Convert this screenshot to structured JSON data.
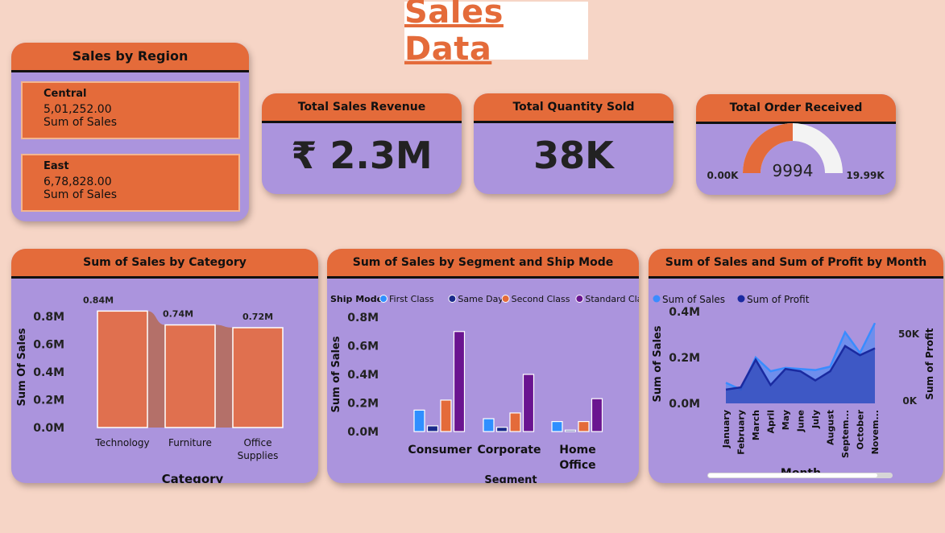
{
  "page": {
    "title": "Sales Data"
  },
  "sales_by_region": {
    "title": "Sales by Region",
    "items": [
      {
        "region": "Central",
        "value": "5,01,252.00",
        "measure": "Sum of Sales"
      },
      {
        "region": "East",
        "value": "6,78,828.00",
        "measure": "Sum of Sales"
      }
    ]
  },
  "kpis": {
    "revenue": {
      "title": "Total Sales Revenue",
      "value": "₹ 2.3M"
    },
    "quantity": {
      "title": "Total Quantity Sold",
      "value": "38K"
    },
    "orders": {
      "title": "Total Order Received",
      "value": "9994",
      "min_label": "0.00K",
      "max_label": "19.99K",
      "value_num": 9994,
      "max_num": 19990
    }
  },
  "colors": {
    "background": "#f6d5c6",
    "card": "#ab94dd",
    "accent": "#e46b3a",
    "first_class": "#2f8fff",
    "same_day": "#1a2a8a",
    "second_class": "#e46b3a",
    "standard_class": "#6a1490",
    "sales": "#3a8cff",
    "profit": "#1a2aa0"
  },
  "chart_data": [
    {
      "type": "bar",
      "title": "Sum of Sales by Category",
      "xlabel": "Category",
      "ylabel": "Sum Of Sales",
      "ylim": [
        0,
        0.9
      ],
      "yticks": [
        "0.0M",
        "0.2M",
        "0.4M",
        "0.6M",
        "0.8M"
      ],
      "categories": [
        "Technology",
        "Furniture",
        "Office Supplies"
      ],
      "values": [
        0.84,
        0.74,
        0.72
      ],
      "data_labels": [
        "0.84M",
        "0.74M",
        "0.72M"
      ]
    },
    {
      "type": "bar",
      "title": "Sum of Sales by Segment and Ship Mode",
      "xlabel": "Segment",
      "ylabel": "Sum of Sales",
      "legend_title": "Ship Mode",
      "legend_position": "top-left",
      "ylim": [
        0,
        0.8
      ],
      "yticks": [
        "0.0M",
        "0.2M",
        "0.4M",
        "0.6M",
        "0.8M"
      ],
      "categories": [
        "Consumer",
        "Corporate",
        "Home Office"
      ],
      "series": [
        {
          "name": "First Class",
          "values": [
            0.15,
            0.09,
            0.07
          ]
        },
        {
          "name": "Same Day",
          "values": [
            0.04,
            0.03,
            0.01
          ]
        },
        {
          "name": "Second Class",
          "values": [
            0.22,
            0.13,
            0.07
          ]
        },
        {
          "name": "Standard Class",
          "values": [
            0.7,
            0.4,
            0.23
          ]
        }
      ]
    },
    {
      "type": "area",
      "title": "Sum of Sales and Sum of Profit by Month",
      "xlabel": "Month",
      "ylabel": "Sum of Sales",
      "y2label": "Sum of Profit",
      "legend_position": "top-left",
      "ylim": [
        0,
        0.4
      ],
      "yticks": [
        "0.0M",
        "0.2M",
        "0.4M"
      ],
      "y2ticks": [
        "0K",
        "50K"
      ],
      "x": [
        "January",
        "February",
        "March",
        "April",
        "May",
        "June",
        "July",
        "August",
        "Septem...",
        "October",
        "Novem..."
      ],
      "series": [
        {
          "name": "Sum of Sales",
          "values": [
            0.09,
            0.06,
            0.2,
            0.14,
            0.155,
            0.15,
            0.145,
            0.16,
            0.31,
            0.22,
            0.35
          ]
        },
        {
          "name": "Sum of Profit",
          "values": [
            0.06,
            0.07,
            0.19,
            0.08,
            0.15,
            0.14,
            0.1,
            0.14,
            0.25,
            0.21,
            0.24
          ]
        }
      ]
    }
  ]
}
